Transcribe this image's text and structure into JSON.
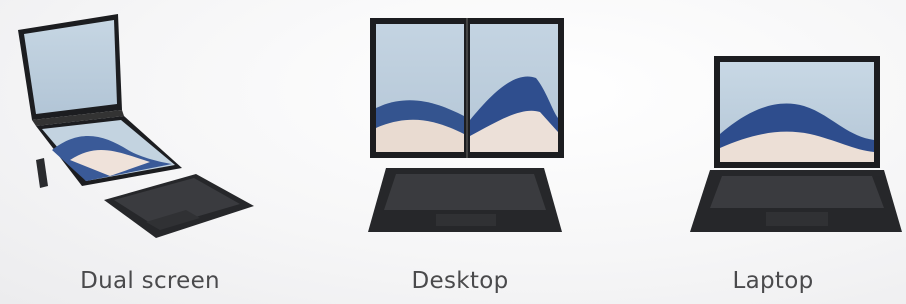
{
  "modes": [
    {
      "label": "Dual screen",
      "icon": "dual-screen-laptop-icon"
    },
    {
      "label": "Desktop",
      "icon": "desktop-stand-laptop-icon"
    },
    {
      "label": "Laptop",
      "icon": "laptop-icon"
    }
  ],
  "colors": {
    "screen_bg": "#bfd0de",
    "wave_dark": "#2c4a8a",
    "wave_light": "#e8d8cf",
    "bezel": "#1e1f22",
    "keyboard": "#26272a"
  }
}
